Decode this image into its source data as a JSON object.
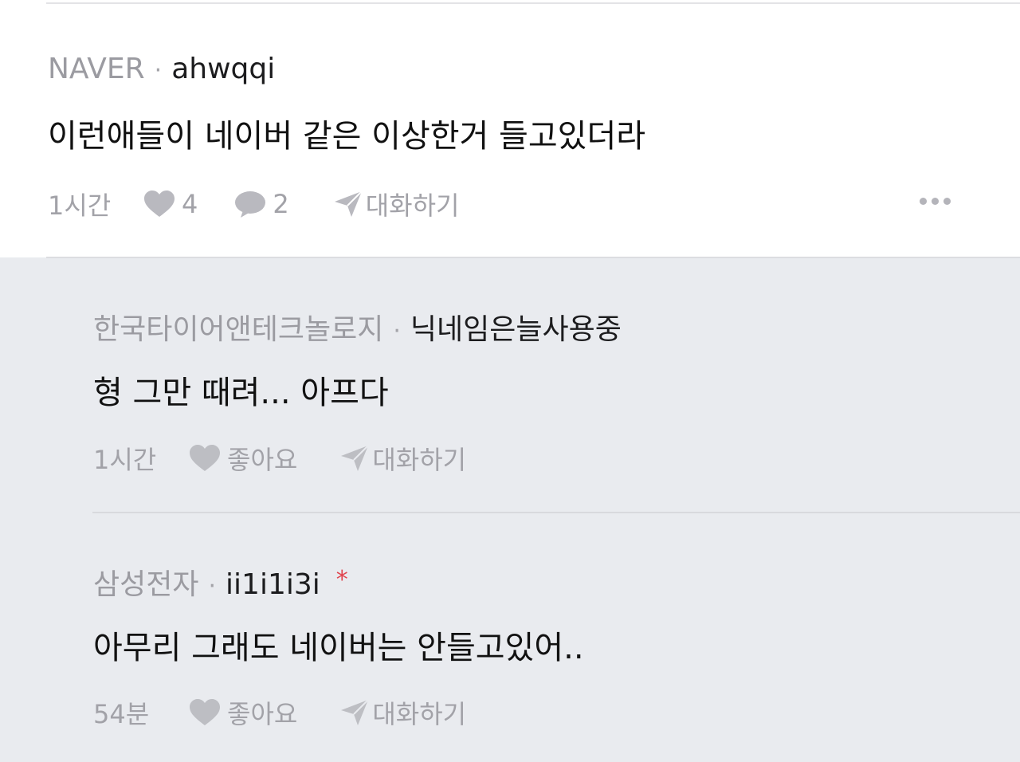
{
  "post": {
    "company": "NAVER",
    "separator": "·",
    "nickname": "ahwqqi",
    "body": "이런애들이 네이버 같은 이상한거 들고있더라",
    "time": "1시간",
    "likes": "4",
    "comments": "2",
    "chat_label": "대화하기"
  },
  "replies": [
    {
      "company": "한국타이어앤테크놀로지",
      "separator": "·",
      "nickname": "닉네임은늘사용중",
      "body": "형 그만 때려... 아프다",
      "time": "1시간",
      "like_label": "좋아요",
      "chat_label": "대화하기"
    },
    {
      "company": "삼성전자",
      "separator": "·",
      "nickname": "ii1i1i3i",
      "badge": "*",
      "body": "아무리 그래도 네이버는 안들고있어..",
      "time": "54분",
      "like_label": "좋아요",
      "chat_label": "대화하기"
    }
  ],
  "colors": {
    "reply_background": "#e9ebef",
    "muted_text": "#a2a2a8",
    "author_badge": "#e0454f"
  },
  "icons": [
    "heart-icon",
    "comment-bubble-icon",
    "send-plane-icon",
    "more-dots-icon"
  ]
}
